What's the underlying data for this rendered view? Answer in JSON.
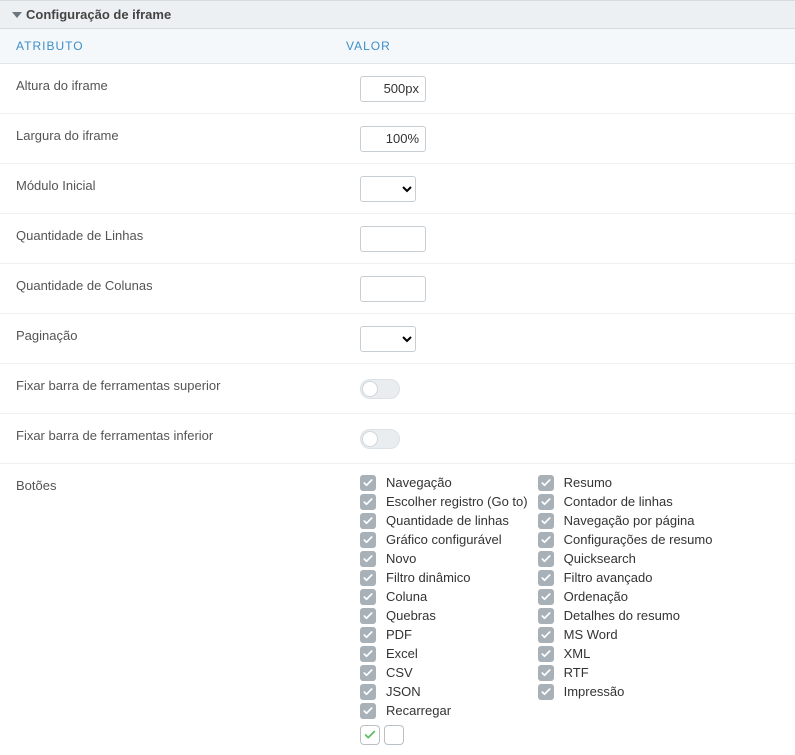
{
  "panel": {
    "title": "Configuração de iframe"
  },
  "headers": {
    "attribute": "ATRIBUTO",
    "value": "VALOR"
  },
  "rows": {
    "height": {
      "label": "Altura do iframe",
      "value": "500px"
    },
    "width": {
      "label": "Largura do iframe",
      "value": "100%"
    },
    "initialModule": {
      "label": "Módulo Inicial"
    },
    "rowsCount": {
      "label": "Quantidade de Linhas",
      "value": ""
    },
    "colsCount": {
      "label": "Quantidade de Colunas",
      "value": ""
    },
    "pagination": {
      "label": "Paginação"
    },
    "fixTop": {
      "label": "Fixar barra de ferramentas superior"
    },
    "fixBottom": {
      "label": "Fixar barra de ferramentas inferior"
    },
    "buttons": {
      "label": "Botões"
    }
  },
  "buttons": {
    "col1": [
      "Navegação",
      "Escolher registro (Go to)",
      "Quantidade de linhas",
      "Gráfico configurável",
      "Novo",
      "Filtro dinâmico",
      "Coluna",
      "Quebras",
      "PDF",
      "Excel",
      "CSV",
      "JSON",
      "Recarregar"
    ],
    "col2": [
      "Resumo",
      "Contador de linhas",
      "Navegação por página",
      "Configurações de resumo",
      "Quicksearch",
      "Filtro avançado",
      "Ordenação",
      "Detalhes do resumo",
      "MS Word",
      "XML",
      "RTF",
      "Impressão"
    ]
  }
}
